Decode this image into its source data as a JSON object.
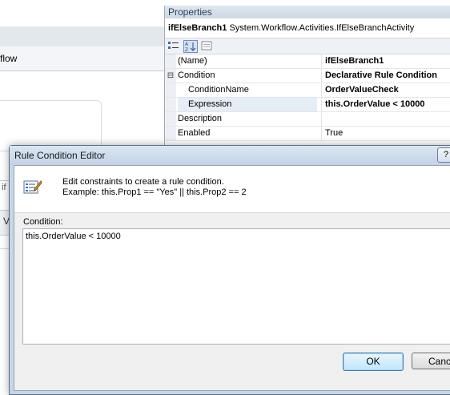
{
  "background": {
    "partial_label": "flow",
    "edge_labels": [
      "if",
      "V"
    ]
  },
  "properties": {
    "title": "Properties",
    "object_name": "ifElseBranch1",
    "object_type": "System.Workflow.Activities.IfElseBranchActivity",
    "rows": [
      {
        "name": "(Name)",
        "value": "ifElseBranch1",
        "value_bold": true,
        "expander": ""
      },
      {
        "name": "Condition",
        "value": "Declarative Rule Condition",
        "value_bold": true,
        "expander": "⊟"
      },
      {
        "name": "ConditionName",
        "value": "OrderValueCheck",
        "value_bold": true,
        "expander": ""
      },
      {
        "name": "Expression",
        "value": "this.OrderValue < 10000",
        "value_bold": true,
        "expander": ""
      },
      {
        "name": "Description",
        "value": "",
        "value_bold": false,
        "expander": ""
      },
      {
        "name": "Enabled",
        "value": "True",
        "value_bold": false,
        "expander": ""
      }
    ]
  },
  "dialog": {
    "title": "Rule Condition Editor",
    "help_label": "?",
    "instruction_line1": "Edit constraints to create a rule condition.",
    "instruction_line2": "Example: this.Prop1 == \"Yes\" || this.Prop2 == 2",
    "condition_label": "Condition:",
    "condition_value": "this.OrderValue < 10000",
    "ok_label": "OK",
    "cancel_label": "Cance"
  },
  "icons": [
    "categorized-icon",
    "alphabetical-sort-icon",
    "property-pages-icon",
    "rule-editor-icon"
  ]
}
